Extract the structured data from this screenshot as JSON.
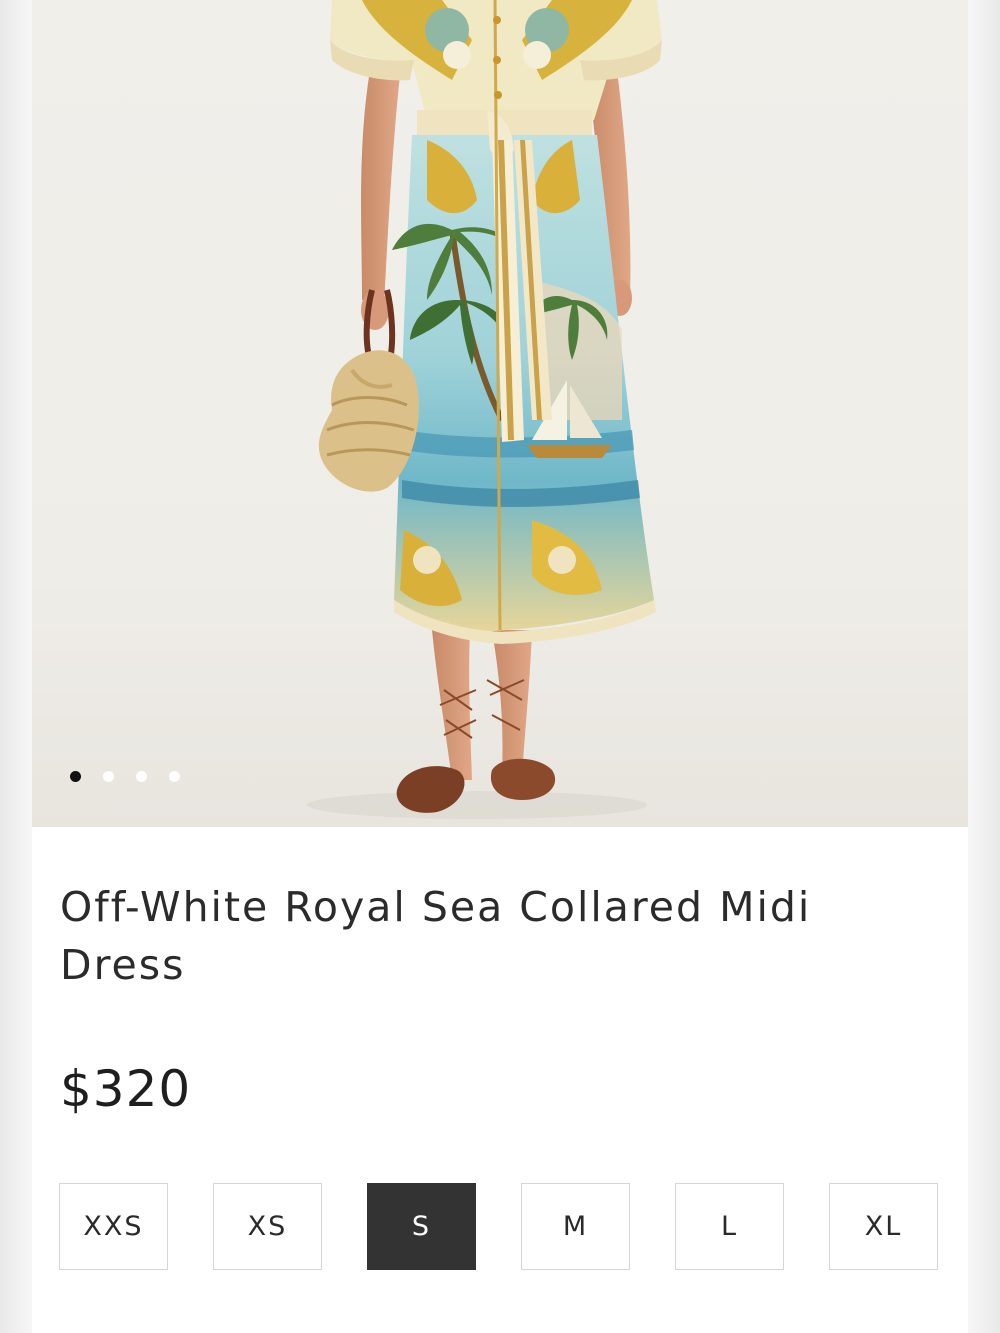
{
  "product": {
    "title": "Off-White Royal Sea Collared Midi Dress",
    "price": "$320"
  },
  "gallery": {
    "image_description": "model wearing printed midi dress with palm trees, sea and shells, holding a straw bag",
    "slide_count": 4,
    "active_slide": 1
  },
  "sizes": {
    "options": [
      "XXS",
      "XS",
      "S",
      "M",
      "L",
      "XL"
    ],
    "selected": "S"
  },
  "colors": {
    "selected_bg": "#333333",
    "border": "#d6d6d6",
    "text": "#2b2b2b"
  }
}
